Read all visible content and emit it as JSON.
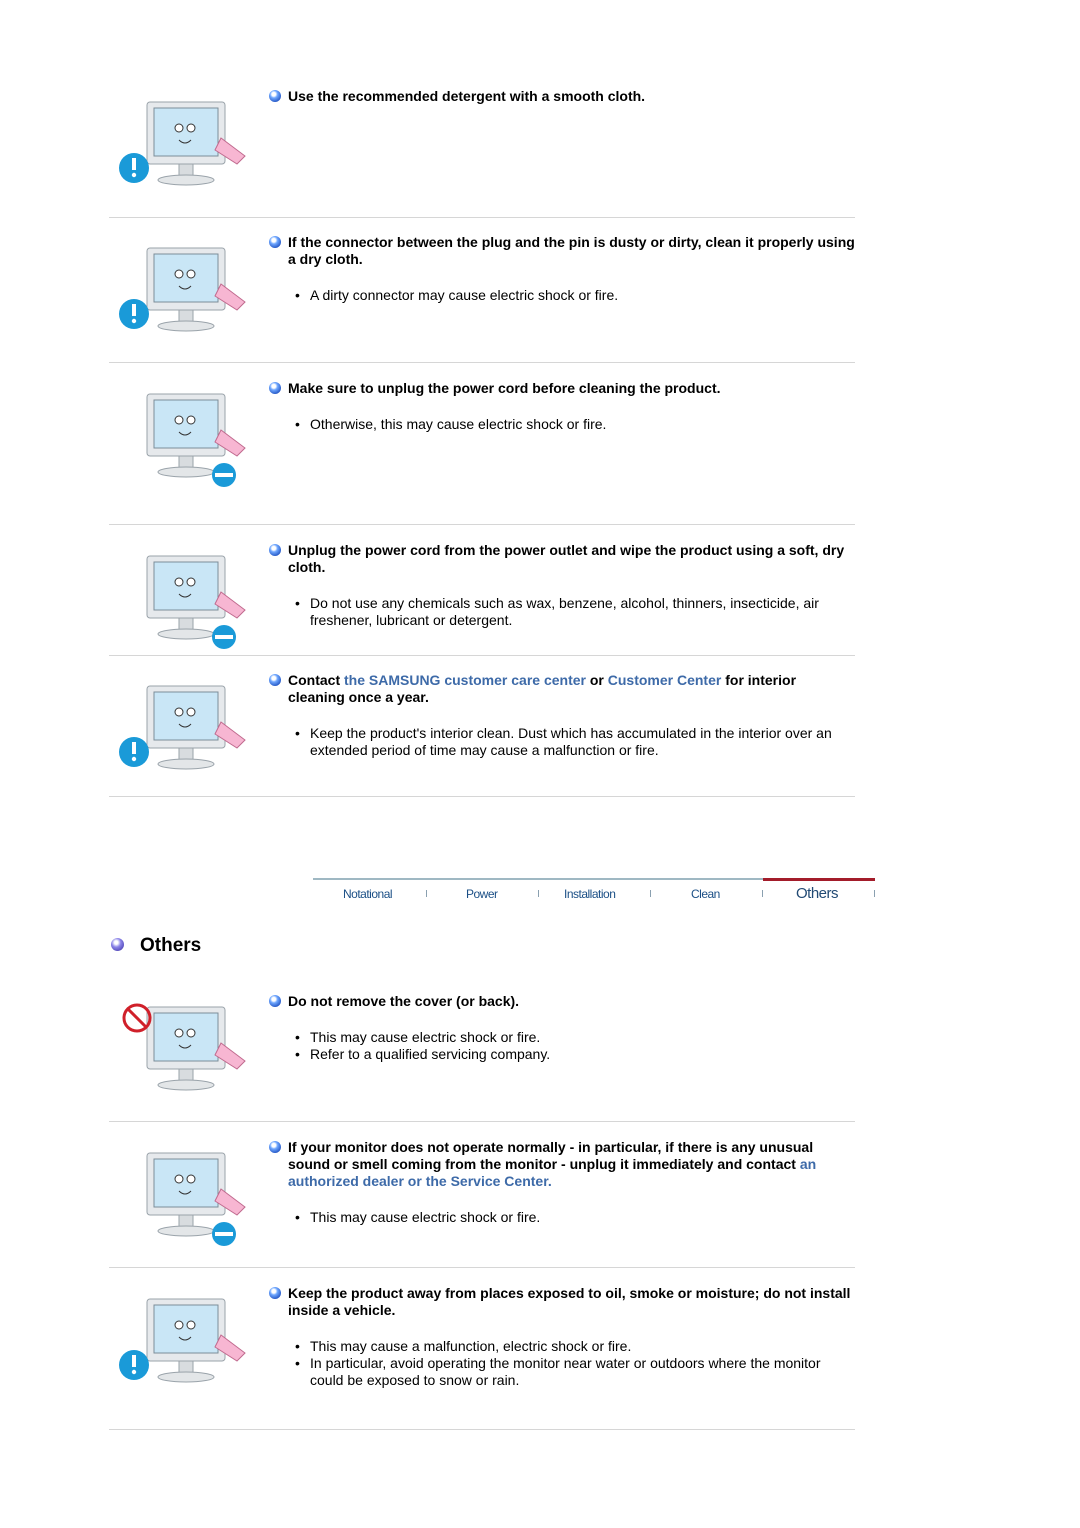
{
  "items_top": [
    {
      "illustration": "monitor-cleaning-cloth-illustration",
      "heading": [
        {
          "text": "Use the recommended detergent with a smooth cloth.",
          "link": false
        }
      ],
      "points": []
    },
    {
      "illustration": "woman-cleaning-plug-illustration",
      "heading": [
        {
          "text": "If the connector between the plug and the pin is dusty or dirty, clean it properly using a dry cloth.",
          "link": false
        }
      ],
      "points": [
        "A dirty connector may cause electric shock or fire."
      ]
    },
    {
      "illustration": "monitor-unplugged-cleaning-illustration",
      "heading": [
        {
          "text": "Make sure to unplug the power cord before cleaning the product.",
          "link": false
        }
      ],
      "points": [
        "Otherwise, this may cause electric shock or fire."
      ]
    },
    {
      "illustration": "woman-wiping-monitor-illustration",
      "heading": [
        {
          "text": "Unplug the power cord from the power outlet and wipe the product using a soft, dry cloth.",
          "link": false
        }
      ],
      "points": [
        "Do not use any chemicals such as wax, benzene, alcohol, thinners, insecticide, air freshener, lubricant or detergent."
      ]
    },
    {
      "illustration": "monitor-phone-call-illustration",
      "heading": [
        {
          "text": "Contact ",
          "link": false
        },
        {
          "text": "the SAMSUNG customer care center",
          "link": true
        },
        {
          "text": " or ",
          "link": false
        },
        {
          "text": "Customer Center",
          "link": true
        },
        {
          "text": " for interior cleaning once a year.",
          "link": false
        }
      ],
      "points": [
        "Keep the product's interior clean. Dust which has accumulated in the interior over an extended period of time may cause a malfunction or fire."
      ]
    }
  ],
  "nav": {
    "tabs": [
      {
        "label": "Notational",
        "active": false
      },
      {
        "label": "Power",
        "active": false
      },
      {
        "label": "Installation",
        "active": false
      },
      {
        "label": "Clean",
        "active": false
      },
      {
        "label": "Others",
        "active": true
      }
    ],
    "active_color": "#a31c2a"
  },
  "section": {
    "title": "Others"
  },
  "items_bottom": [
    {
      "illustration": "man-removing-cover-illustration",
      "heading": [
        {
          "text": "Do not remove the cover (or back).",
          "link": false
        }
      ],
      "points": [
        "This may cause electric shock or fire.",
        "Refer to a qualified servicing company."
      ]
    },
    {
      "illustration": "monitor-smoke-unplug-illustration",
      "heading": [
        {
          "text": "If your monitor does not operate normally - in particular, if there is any unusual sound or smell coming from the monitor - unplug it immediately and contact ",
          "link": false
        },
        {
          "text": "an authorized dealer or the Service Center.",
          "link": true
        }
      ],
      "points": [
        "This may cause electric shock or fire."
      ]
    },
    {
      "illustration": "monitor-rain-window-illustration",
      "heading": [
        {
          "text": "Keep the product away from places exposed to oil, smoke or moisture; do not install inside a vehicle.",
          "link": false
        }
      ],
      "points": [
        "This may cause a malfunction, electric shock or fire.",
        "In particular, avoid operating the monitor near water or outdoors where the monitor could be exposed to snow or rain."
      ]
    }
  ],
  "colors": {
    "link": "#3d6aa8",
    "divider": "#d6d6d6",
    "nav_text": "#1b4f86"
  }
}
